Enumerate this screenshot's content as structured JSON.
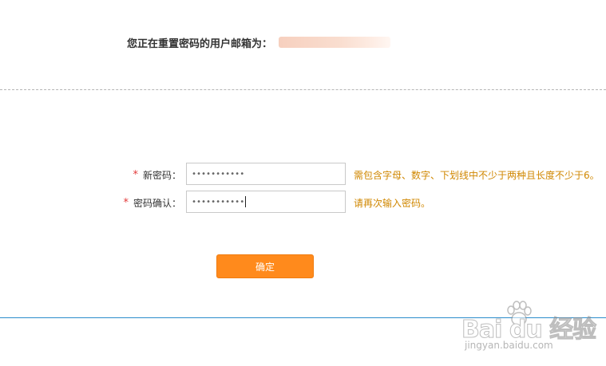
{
  "header": {
    "email_label": "您正在重置密码的用户邮箱为："
  },
  "form": {
    "new_password": {
      "required_mark": "*",
      "label": "新密码：",
      "masked_value": "•••••••••••",
      "hint": "需包含字母、数字、下划线中不少于两种且长度不少于6。"
    },
    "confirm_password": {
      "required_mark": "*",
      "label": "密码确认：",
      "masked_value": "•••••••••••",
      "hint": "请再次输入密码。"
    },
    "submit_label": "确定"
  },
  "watermark": {
    "brand": "Bai du 经验",
    "url": "jingyan.baidu.com"
  },
  "colors": {
    "accent_button": "#ff8a1c",
    "hint_text": "#d08700",
    "required_star": "#e23a3a",
    "bottom_rule": "#2b8ccc"
  }
}
